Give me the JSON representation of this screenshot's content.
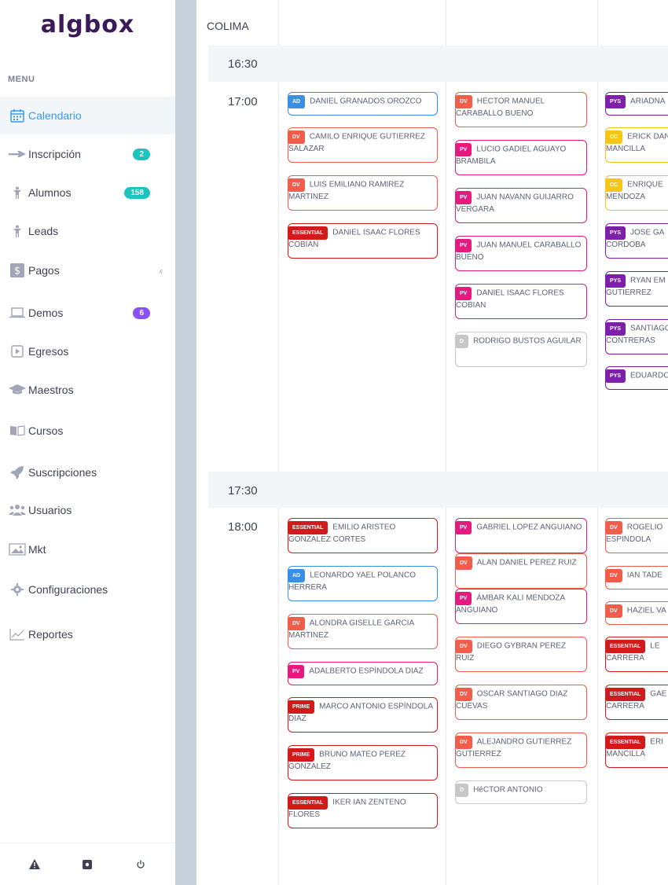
{
  "app": {
    "logo": "algbox"
  },
  "sidebar": {
    "menu_label": "MENU",
    "items": [
      {
        "label": "Calendario",
        "icon": "calendar-icon",
        "active": true
      },
      {
        "label": "Inscripción",
        "icon": "plane-icon",
        "badge": "2",
        "badge_color": "#1bc5bd"
      },
      {
        "label": "Alumnos",
        "icon": "person-icon",
        "badge": "158",
        "badge_color": "#1bc5bd"
      },
      {
        "label": "Leads",
        "icon": "person-icon"
      },
      {
        "label": "Pagos",
        "icon": "dollar-icon",
        "chevron": "‹"
      },
      {
        "label": "Demos",
        "icon": "laptop-icon",
        "badge": "6",
        "badge_color": "#8950fc"
      },
      {
        "label": "Egresos",
        "icon": "play-icon"
      },
      {
        "label": "Maestros",
        "icon": "graduation-cap-icon"
      },
      {
        "label": "Cursos",
        "icon": "book-icon"
      },
      {
        "label": "Suscripciones",
        "icon": "rocket-icon"
      },
      {
        "label": "Usuarios",
        "icon": "users-icon"
      },
      {
        "label": "Mkt",
        "icon": "image-icon"
      },
      {
        "label": "Configuraciones",
        "icon": "gear-icon"
      },
      {
        "label": "Reportes",
        "icon": "chart-line-icon"
      }
    ]
  },
  "footer_icons": [
    "warning-icon",
    "settings-box-icon",
    "power-icon"
  ],
  "calendar": {
    "place": "COLIMA",
    "times": [
      "16:30",
      "17:00",
      "17:30",
      "18:00"
    ],
    "colors": {
      "AD": "#3a8ee6",
      "DV": "#f25c4a",
      "ESSENTIAL": "#d11b1b",
      "PV": "#e6197e",
      "D": "#c7c7c7",
      "PYS": "#7d1fa8",
      "CC": "#f5c518",
      "PRIME": "#d11b1b"
    },
    "slot_1700": [
      [
        {
          "tag": "AD",
          "name": "DANIEL GRANADOS OROZCO"
        },
        {
          "tag": "DV",
          "name": "CAMILO ENRIQUE GUTIERREZ SALAZAR"
        },
        {
          "tag": "DV",
          "name": "LUIS EMILIANO RAMIREZ MARTINEZ"
        },
        {
          "tag": "ESSENTIAL",
          "name": "DANIEL ISAAC FLORES COBIAN"
        }
      ],
      [
        {
          "tag": "DV",
          "name": "HECTOR MANUEL CARABALLO BUENO"
        },
        {
          "tag": "PV",
          "name": "LUCIO GADIEL AGUAYO BRAMBILA"
        },
        {
          "tag": "PV",
          "name": "JUAN NAVANN GUIJARRO VERGARA"
        },
        {
          "tag": "PV",
          "name": "JUAN MANUEL CARABALLO BUENO"
        },
        {
          "tag": "PV",
          "name": "DANIEL ISAAC FLORES COBIAN"
        },
        {
          "tag": "D",
          "name": "RODRIGO BUSTOS AGUILAR"
        }
      ],
      [
        {
          "tag": "PYS",
          "name": "ARIADNA"
        },
        {
          "tag": "CC",
          "name": "ERICK DANIEL MANCILLA"
        },
        {
          "tag": "CC",
          "name": "ENRIQUE MENDOZA"
        },
        {
          "tag": "PYS",
          "name": "JOSE GA CORDOBA"
        },
        {
          "tag": "PYS",
          "name": "RYAN EM GUTIERREZ"
        },
        {
          "tag": "PYS",
          "name": "SANTIAGO CONTRERAS"
        },
        {
          "tag": "PYS",
          "name": "EDUARDO"
        }
      ]
    ],
    "slot_1800": [
      [
        {
          "tag": "ESSENTIAL",
          "name": "EMILIO ARISTEO GONZALEZ CORTES"
        },
        {
          "tag": "AD",
          "name": "LEONARDO YAEL POLANCO HERRERA"
        },
        {
          "tag": "DV",
          "name": "ALONDRA GISELLE GARCIA MARTINEZ"
        },
        {
          "tag": "PV",
          "name": "ADALBERTO ESPÍNDOLA DIAZ"
        },
        {
          "tag": "PRIME",
          "name": "MARCO ANTONIO ESPÍNDOLA DIAZ"
        },
        {
          "tag": "PRIME",
          "name": "BRUNO MATEO PEREZ GONZALEZ"
        },
        {
          "tag": "ESSENTIAL",
          "name": "IKER IAN ZENTENO FLORES"
        }
      ],
      [
        {
          "tag": "PV",
          "name": "GABRIEL LOPEZ ANGUIANO"
        },
        {
          "tag": "DV",
          "name": "ALAN DANIEL PEREZ RUIZ"
        },
        {
          "tag": "PV",
          "name": "ÁMBAR KALI MENDOZA ANGUIANO"
        },
        {
          "tag": "DV",
          "name": "DIEGO GYBRAN PEREZ RUIZ"
        },
        {
          "tag": "DV",
          "name": "OSCAR SANTIAGO DIAZ CUEVAS"
        },
        {
          "tag": "DV",
          "name": "ALEJANDRO GUTIERREZ GUTIERREZ"
        },
        {
          "tag": "D",
          "name": "HéCTOR ANTONIO"
        }
      ],
      [
        {
          "tag": "DV",
          "name": "ROGELIO ESPINDOLA"
        },
        {
          "tag": "DV",
          "name": "IAN TADE"
        },
        {
          "tag": "DV",
          "name": "HAZIEL VA"
        },
        {
          "tag": "ESSENTIAL",
          "name": "LE CARRERA"
        },
        {
          "tag": "ESSENTIAL",
          "name": "GAE CARRERA"
        },
        {
          "tag": "ESSENTIAL",
          "name": "ERI MANCILLA"
        }
      ]
    ]
  }
}
